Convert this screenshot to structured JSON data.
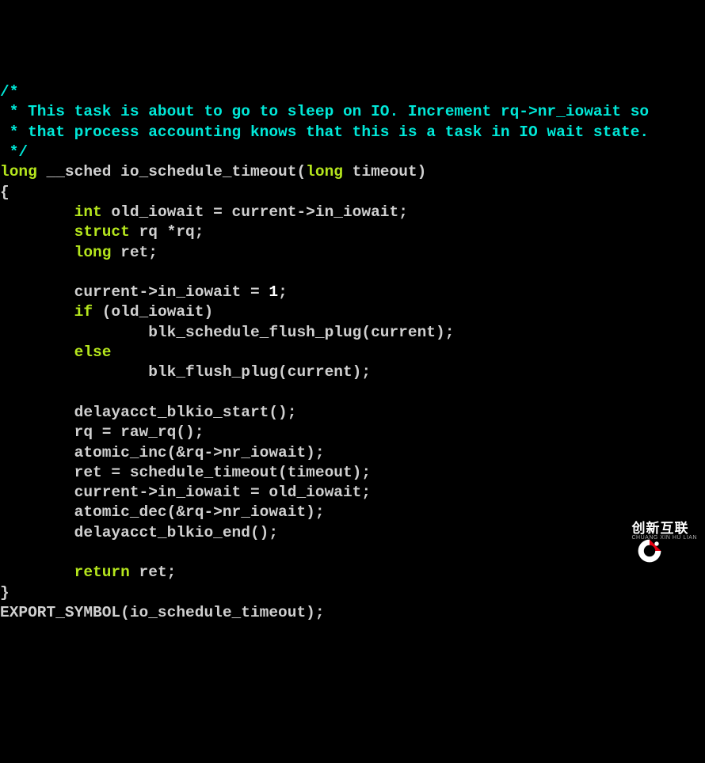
{
  "code": {
    "comment_l1": "/*",
    "comment_l2": " * This task is about to go to sleep on IO. Increment rq->nr_iowait so",
    "comment_l3": " * that process accounting knows that this is a task in IO wait state.",
    "comment_l4": " */",
    "kw_long1": "long",
    "sig_rest": " __sched io_schedule_timeout(",
    "kw_long2": "long",
    "sig_end": " timeout)",
    "brace_open": "{",
    "indent2": "        ",
    "kw_int": "int",
    "decl_old_iowait": " old_iowait = current->in_iowait;",
    "kw_struct": "struct",
    "decl_rq": " rq *rq;",
    "kw_long3": "long",
    "decl_ret": " ret;",
    "assign_iowait_pre": "        current->in_iowait = ",
    "num_1": "1",
    "semicolon": ";",
    "kw_if": "if",
    "if_cond": " (old_iowait)",
    "indent4": "                ",
    "call_blk_sched": "blk_schedule_flush_plug(current);",
    "kw_else": "else",
    "call_blk_flush": "blk_flush_plug(current);",
    "call_delay_start": "        delayacct_blkio_start();",
    "call_rawrq": "        rq = raw_rq();",
    "call_atomic_inc": "        atomic_inc(&rq->nr_iowait);",
    "call_sched_timeout": "        ret = schedule_timeout(timeout);",
    "assign_back": "        current->in_iowait = old_iowait;",
    "call_atomic_dec": "        atomic_dec(&rq->nr_iowait);",
    "call_delay_end": "        delayacct_blkio_end();",
    "kw_return": "return",
    "ret_val": " ret;",
    "brace_close": "}",
    "export_sym": "EXPORT_SYMBOL(io_schedule_timeout);"
  },
  "logo": {
    "cn": "创新互联",
    "en": "CHUANG XIN HU LIAN"
  }
}
